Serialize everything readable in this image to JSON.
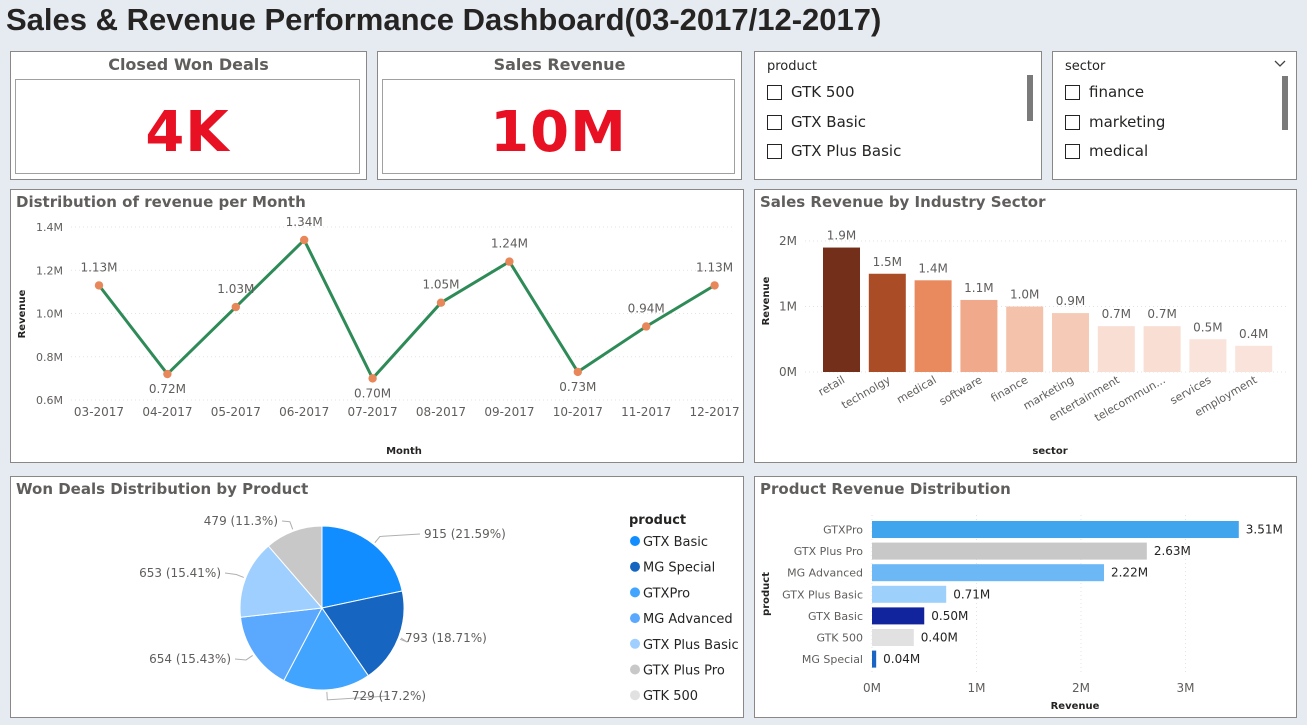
{
  "title": "Sales & Revenue Performance Dashboard(03-2017/12-2017)",
  "kpis": {
    "won_deals": {
      "label": "Closed Won Deals",
      "value": "4K"
    },
    "revenue": {
      "label": "Sales Revenue",
      "value": "10M"
    }
  },
  "slicers": {
    "product": {
      "header": "product",
      "items": [
        "GTK 500",
        "GTX Basic",
        "GTX Plus Basic"
      ]
    },
    "sector": {
      "header": "sector",
      "items": [
        "finance",
        "marketing",
        "medical"
      ]
    }
  },
  "charts": {
    "line_title": "Distribution of revenue per Month",
    "sector_title": "Sales Revenue by Industry Sector",
    "pie_title": "Won Deals Distribution by Product",
    "product_title": "Product Revenue Distribution"
  },
  "colors": {
    "line": "#2e8b57",
    "marker": "#e8875a",
    "kpi": "#e81123",
    "sector_bars": [
      "#732f19",
      "#aa4c26",
      "#e88a5e",
      "#f0a98b",
      "#f4c2ab",
      "#f5cbb7",
      "#f9ded3",
      "#f9ded3",
      "#fae3da",
      "#fae3da"
    ],
    "product_bars": [
      "#41a5ee",
      "#c8c8c8",
      "#6cb8f6",
      "#9dd0fb",
      "#12239e",
      "#e1e1e1",
      "#1a64c3"
    ],
    "pie": [
      "#118dff",
      "#1665c1",
      "#41a5ff",
      "#5aa9ff",
      "#9fcfff",
      "#c8c8c8",
      "#e1e1e1"
    ]
  },
  "chart_data": [
    {
      "type": "line",
      "title": "Distribution of revenue per Month",
      "xlabel": "Month",
      "ylabel": "Revenue",
      "categories": [
        "03-2017",
        "04-2017",
        "05-2017",
        "06-2017",
        "07-2017",
        "08-2017",
        "09-2017",
        "10-2017",
        "11-2017",
        "12-2017"
      ],
      "values": [
        1.13,
        0.72,
        1.03,
        1.34,
        0.7,
        1.05,
        1.24,
        0.73,
        0.94,
        1.13
      ],
      "data_labels": [
        "1.13M",
        "0.72M",
        "1.03M",
        "1.34M",
        "0.70M",
        "1.05M",
        "1.24M",
        "0.73M",
        "0.94M",
        "1.13M"
      ],
      "ylim": [
        0.6,
        1.4
      ],
      "yticks": [
        "0.6M",
        "0.8M",
        "1.0M",
        "1.2M",
        "1.4M"
      ]
    },
    {
      "type": "bar",
      "title": "Sales Revenue by Industry Sector",
      "xlabel": "sector",
      "ylabel": "Revenue",
      "categories": [
        "retail",
        "technolgy",
        "medical",
        "software",
        "finance",
        "marketing",
        "entertainment",
        "telecommun...",
        "services",
        "employment"
      ],
      "values": [
        1.9,
        1.5,
        1.4,
        1.1,
        1.0,
        0.9,
        0.7,
        0.7,
        0.5,
        0.4
      ],
      "data_labels": [
        "1.9M",
        "1.5M",
        "1.4M",
        "1.1M",
        "1.0M",
        "0.9M",
        "0.7M",
        "0.7M",
        "0.5M",
        "0.4M"
      ],
      "ylim": [
        0,
        2
      ],
      "yticks": [
        "0M",
        "1M",
        "2M"
      ]
    },
    {
      "type": "pie",
      "title": "Won Deals Distribution by Product",
      "legend_title": "product",
      "categories": [
        "GTX Basic",
        "MG Special",
        "GTXPro",
        "MG Advanced",
        "GTX Plus Basic",
        "GTX Plus Pro",
        "GTK 500"
      ],
      "values": [
        915,
        793,
        729,
        654,
        653,
        479,
        0
      ],
      "data_labels": [
        "915 (21.59%)",
        "793 (18.71%)",
        "729 (17.2%)",
        "654 (15.43%)",
        "653 (15.41%)",
        "479 (11.3%)"
      ],
      "legend_position": "right"
    },
    {
      "type": "bar",
      "orientation": "horizontal",
      "title": "Product Revenue Distribution",
      "xlabel": "Revenue",
      "ylabel": "product",
      "categories": [
        "GTXPro",
        "GTX Plus Pro",
        "MG Advanced",
        "GTX Plus Basic",
        "GTX Basic",
        "GTK 500",
        "MG Special"
      ],
      "values": [
        3.51,
        2.63,
        2.22,
        0.71,
        0.5,
        0.4,
        0.04
      ],
      "data_labels": [
        "3.51M",
        "2.63M",
        "2.22M",
        "0.71M",
        "0.50M",
        "0.40M",
        "0.04M"
      ],
      "xlim": [
        0,
        3.8
      ],
      "xticks": [
        "0M",
        "1M",
        "2M",
        "3M"
      ]
    }
  ]
}
